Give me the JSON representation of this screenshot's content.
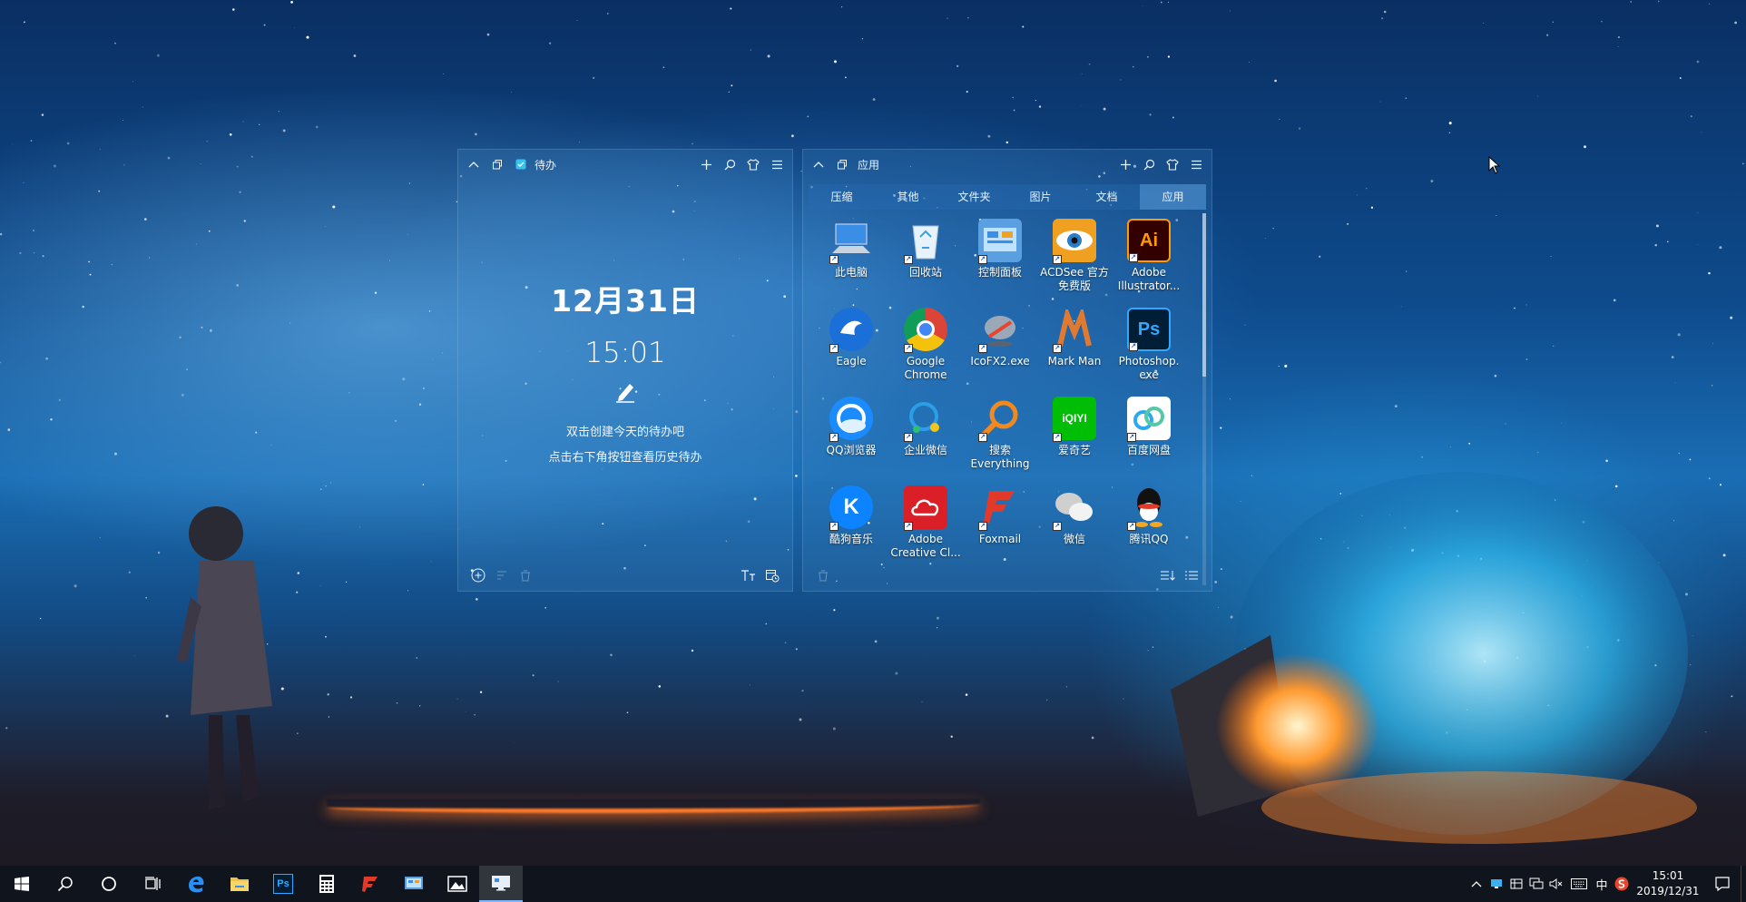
{
  "todo_widget": {
    "title": "待办",
    "date": "12月31日",
    "time": "15:01",
    "hint_line1": "双击创建今天的待办吧",
    "hint_line2": "点击右下角按钮查看历史待办"
  },
  "apps_widget": {
    "title": "应用",
    "tabs": [
      "压缩",
      "其他",
      "文件夹",
      "图片",
      "文档",
      "应用"
    ],
    "active_tab": "应用",
    "apps": [
      {
        "label": "此电脑",
        "icon": "computer-icon",
        "color": "#3a8ee6"
      },
      {
        "label": "回收站",
        "icon": "recycle-bin-icon",
        "color": "#d8e6f2"
      },
      {
        "label": "控制面板",
        "icon": "control-panel-icon",
        "color": "#5aa0e0"
      },
      {
        "label": "ACDSee 官方免费版",
        "icon": "acdsee-icon",
        "color": "#f0a020"
      },
      {
        "label": "Adobe Illustrator...",
        "icon": "illustrator-icon",
        "color": "#330000"
      },
      {
        "label": "Eagle",
        "icon": "eagle-icon",
        "color": "#1b6fd8"
      },
      {
        "label": "Google Chrome",
        "icon": "chrome-icon",
        "color": "#ffffff"
      },
      {
        "label": "IcoFX2.exe",
        "icon": "icofx-icon",
        "color": "#6a6a6a"
      },
      {
        "label": "Mark Man",
        "icon": "markman-icon",
        "color": "#e07a30"
      },
      {
        "label": "Photoshop. exe",
        "icon": "photoshop-icon",
        "color": "#001e36"
      },
      {
        "label": "QQ浏览器",
        "icon": "qq-browser-icon",
        "color": "#1a8cff"
      },
      {
        "label": "企业微信",
        "icon": "wecom-icon",
        "color": "#2b9ee8"
      },
      {
        "label": "搜索 Everything",
        "icon": "everything-icon",
        "color": "#f08a20"
      },
      {
        "label": "爱奇艺",
        "icon": "iqiyi-icon",
        "color": "#00be06"
      },
      {
        "label": "百度网盘",
        "icon": "baidu-netdisk-icon",
        "color": "#ffffff"
      },
      {
        "label": "酷狗音乐",
        "icon": "kugou-icon",
        "color": "#0d84ff"
      },
      {
        "label": "Adobe Creative Cl...",
        "icon": "creative-cloud-icon",
        "color": "#da1f26"
      },
      {
        "label": "Foxmail",
        "icon": "foxmail-icon",
        "color": "#e23a2a"
      },
      {
        "label": "微信",
        "icon": "wechat-icon",
        "color": "#d9d9d9"
      },
      {
        "label": "腾讯QQ",
        "icon": "qq-icon",
        "color": "#1a1a1a"
      }
    ]
  },
  "app_glyphs": {
    "illustrator": "Ai",
    "photoshop": "Ps",
    "iqiyi": "iQIYI",
    "kugou": "K"
  },
  "taskbar": {
    "apps": [
      "start-icon",
      "search-icon",
      "cortana-icon",
      "task-view-icon",
      "edge-icon",
      "file-explorer-icon",
      "photoshop-icon",
      "calculator-icon",
      "foxmail-icon",
      "control-panel-icon",
      "photos-icon",
      "desktop-widget-icon"
    ],
    "photoshop_glyph": "Ps",
    "ime": "中",
    "clock_time": "15:01",
    "clock_date": "2019/12/31"
  }
}
